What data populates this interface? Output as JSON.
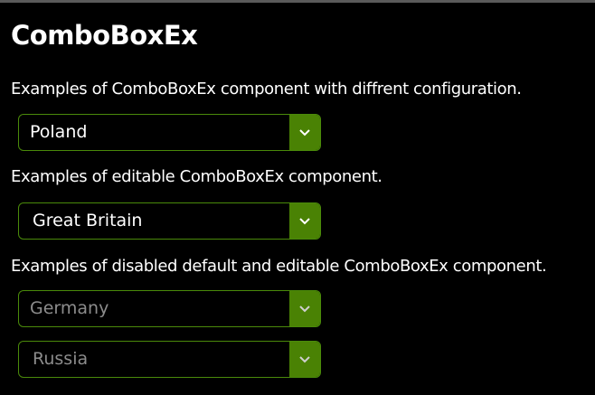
{
  "title": "ComboBoxEx",
  "sections": [
    {
      "description": "Examples of ComboBoxEx component with diffrent configuration."
    },
    {
      "description": "Examples of editable ComboBoxEx component."
    },
    {
      "description": "Examples of disabled default and editable ComboBoxEx component."
    }
  ],
  "combos": [
    {
      "value": "Poland"
    },
    {
      "value": "Great Britain"
    },
    {
      "value": "Germany"
    },
    {
      "value": "Russia"
    }
  ],
  "colors": {
    "accent": "#4a8204",
    "disabled_text": "#8c8c8c"
  }
}
